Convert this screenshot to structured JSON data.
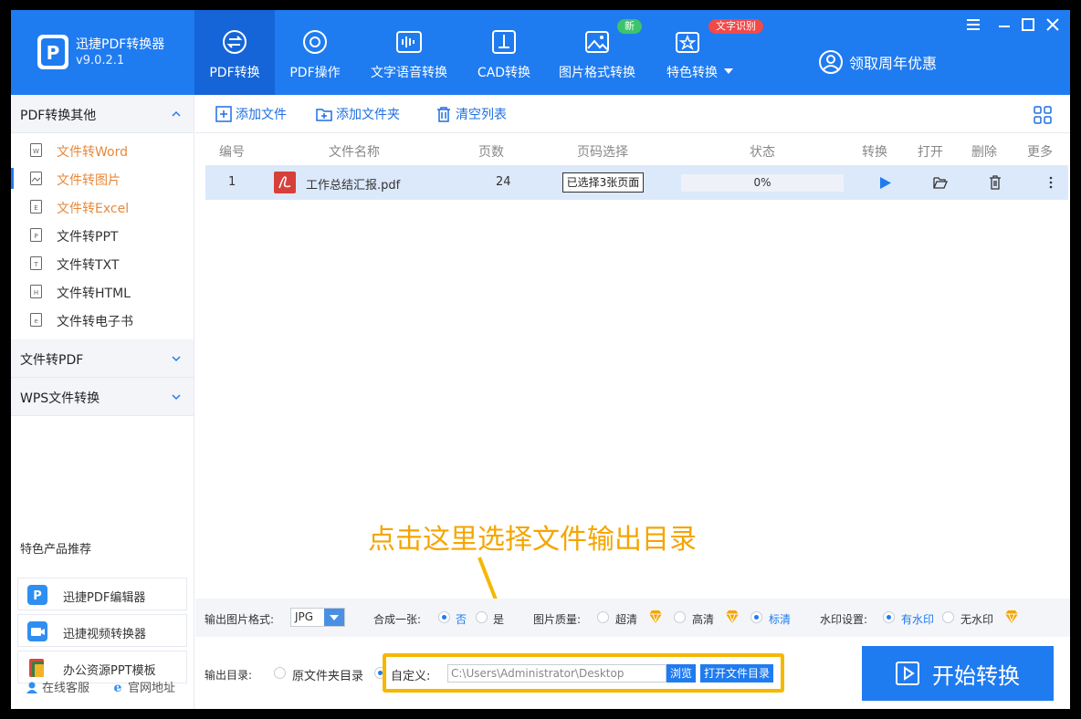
{
  "app": {
    "name": "迅捷PDF转换器",
    "version": "v9.0.2.1"
  },
  "nav": [
    {
      "label": "PDF转换",
      "icon": "pdf-convert-icon",
      "active": true
    },
    {
      "label": "PDF操作",
      "icon": "pdf-operation-icon"
    },
    {
      "label": "文字语音转换",
      "icon": "audio-wave-icon"
    },
    {
      "label": "CAD转换",
      "icon": "cad-icon"
    },
    {
      "label": "图片格式转换",
      "icon": "image-icon"
    },
    {
      "label": "特色转换",
      "icon": "special-convert-icon"
    }
  ],
  "badges": {
    "new": "新",
    "ocr": "文字识别"
  },
  "promo": {
    "label": "领取周年优惠",
    "icon": "user-circle-icon"
  },
  "sidebar": {
    "group1": "PDF转换其他",
    "items": [
      {
        "label": "文件转Word",
        "icon": "word-doc-icon"
      },
      {
        "label": "文件转图片",
        "icon": "image-doc-icon"
      },
      {
        "label": "文件转Excel",
        "icon": "excel-doc-icon"
      },
      {
        "label": "文件转PPT",
        "icon": "ppt-doc-icon"
      },
      {
        "label": "文件转TXT",
        "icon": "txt-doc-icon"
      },
      {
        "label": "文件转HTML",
        "icon": "html-doc-icon"
      },
      {
        "label": "文件转电子书",
        "icon": "ebook-doc-icon"
      }
    ],
    "group2": "文件转PDF",
    "group3": "WPS文件转换",
    "featured_title": "特色产品推荐",
    "featured": [
      {
        "label": "迅捷PDF编辑器",
        "icon": "pdf-editor-icon"
      },
      {
        "label": "迅捷视频转换器",
        "icon": "video-converter-icon"
      },
      {
        "label": "办公资源PPT模板",
        "icon": "ppt-template-icon"
      }
    ],
    "footer": {
      "service": "在线客服",
      "website": "官网地址"
    }
  },
  "toolbar": {
    "add_file": "添加文件",
    "add_folder": "添加文件夹",
    "clear_list": "清空列表"
  },
  "table": {
    "headers": [
      "编号",
      "文件名称",
      "页数",
      "页码选择",
      "状态",
      "转换",
      "打开",
      "删除",
      "更多"
    ],
    "rows": [
      {
        "index": "1",
        "name": "工作总结汇报.pdf",
        "pages": "24",
        "page_select": "已选择3张页面",
        "status": "0%"
      }
    ]
  },
  "instruction": "点击这里选择文件输出目录",
  "options": {
    "format_label": "输出图片格式:",
    "format_value": "JPG",
    "merge_label": "合成一张:",
    "merge_no": "否",
    "merge_yes": "是",
    "quality_label": "图片质量:",
    "quality": [
      "超清",
      "高清",
      "标清"
    ],
    "watermark_label": "水印设置:",
    "watermark_yes": "有水印",
    "watermark_no": "无水印"
  },
  "output": {
    "label": "输出目录:",
    "original": "原文件夹目录",
    "custom": "自定义:",
    "path": "C:\\Users\\Administrator\\Desktop",
    "browse": "浏览",
    "open_folder": "打开文件目录",
    "start": "开始转换"
  },
  "colors": {
    "brand": "#1f7bf0",
    "accent_orange": "#f5a500",
    "highlight": "#f5b800"
  }
}
